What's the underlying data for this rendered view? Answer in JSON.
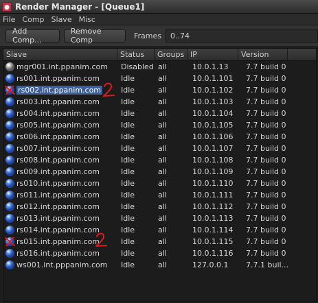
{
  "window": {
    "title": "Render Manager - [Queue1]"
  },
  "menu": [
    "File",
    "Comp",
    "Slave",
    "Misc"
  ],
  "toolbar": {
    "add_comp": "Add Comp...",
    "remove_comp": "Remove Comp",
    "frames_label": "Frames",
    "frames_value": "0..74"
  },
  "columns": [
    "Slave",
    "Status",
    "Groups",
    "IP",
    "Version"
  ],
  "rows": [
    {
      "slave": "mgr001.int.ppanim.com",
      "status": "Disabled",
      "groups": "all",
      "ip": "10.0.1.13",
      "version": "7.7 build 0",
      "icon": "gray-sphere-icon",
      "marked": false,
      "selected": false
    },
    {
      "slave": "rs001.int.ppanim.com",
      "status": "Idle",
      "groups": "all",
      "ip": "10.0.1.101",
      "version": "7.7 build 0",
      "icon": "blue-sphere-icon",
      "marked": false,
      "selected": false
    },
    {
      "slave": "rs002.int.ppanim.com",
      "status": "Idle",
      "groups": "all",
      "ip": "10.0.1.102",
      "version": "7.7 build 0",
      "icon": "blue-sphere-icon",
      "marked": true,
      "selected": true
    },
    {
      "slave": "rs003.int.ppanim.com",
      "status": "Idle",
      "groups": "all",
      "ip": "10.0.1.103",
      "version": "7.7 build 0",
      "icon": "blue-sphere-icon",
      "marked": false,
      "selected": false
    },
    {
      "slave": "rs004.int.ppanim.com",
      "status": "Idle",
      "groups": "all",
      "ip": "10.0.1.104",
      "version": "7.7 build 0",
      "icon": "blue-sphere-icon",
      "marked": false,
      "selected": false
    },
    {
      "slave": "rs005.int.ppanim.com",
      "status": "Idle",
      "groups": "all",
      "ip": "10.0.1.105",
      "version": "7.7 build 0",
      "icon": "blue-sphere-icon",
      "marked": false,
      "selected": false
    },
    {
      "slave": "rs006.int.ppanim.com",
      "status": "Idle",
      "groups": "all",
      "ip": "10.0.1.106",
      "version": "7.7 build 0",
      "icon": "blue-sphere-icon",
      "marked": false,
      "selected": false
    },
    {
      "slave": "rs007.int.ppanim.com",
      "status": "Idle",
      "groups": "all",
      "ip": "10.0.1.107",
      "version": "7.7 build 0",
      "icon": "blue-sphere-icon",
      "marked": false,
      "selected": false
    },
    {
      "slave": "rs008.int.ppanim.com",
      "status": "Idle",
      "groups": "all",
      "ip": "10.0.1.108",
      "version": "7.7 build 0",
      "icon": "blue-sphere-icon",
      "marked": false,
      "selected": false
    },
    {
      "slave": "rs009.int.ppanim.com",
      "status": "Idle",
      "groups": "all",
      "ip": "10.0.1.109",
      "version": "7.7 build 0",
      "icon": "blue-sphere-icon",
      "marked": false,
      "selected": false
    },
    {
      "slave": "rs010.int.ppanim.com",
      "status": "Idle",
      "groups": "all",
      "ip": "10.0.1.110",
      "version": "7.7 build 0",
      "icon": "blue-sphere-icon",
      "marked": false,
      "selected": false
    },
    {
      "slave": "rs011.int.ppanim.com",
      "status": "Idle",
      "groups": "all",
      "ip": "10.0.1.111",
      "version": "7.7 build 0",
      "icon": "blue-sphere-icon",
      "marked": false,
      "selected": false
    },
    {
      "slave": "rs012.int.ppanim.com",
      "status": "Idle",
      "groups": "all",
      "ip": "10.0.1.112",
      "version": "7.7 build 0",
      "icon": "blue-sphere-icon",
      "marked": false,
      "selected": false
    },
    {
      "slave": "rs013.int.ppanim.com",
      "status": "Idle",
      "groups": "all",
      "ip": "10.0.1.113",
      "version": "7.7 build 0",
      "icon": "blue-sphere-icon",
      "marked": false,
      "selected": false
    },
    {
      "slave": "rs014.int.ppanim.com",
      "status": "Idle",
      "groups": "all",
      "ip": "10.0.1.114",
      "version": "7.7 build 0",
      "icon": "blue-sphere-icon",
      "marked": false,
      "selected": false
    },
    {
      "slave": "rs015.int.ppanim.com",
      "status": "Idle",
      "groups": "all",
      "ip": "10.0.1.115",
      "version": "7.7 build 0",
      "icon": "blue-sphere-icon",
      "marked": true,
      "selected": false
    },
    {
      "slave": "rs016.int.ppanim.com",
      "status": "Idle",
      "groups": "all",
      "ip": "10.0.1.116",
      "version": "7.7 build 0",
      "icon": "blue-sphere-icon",
      "marked": false,
      "selected": false
    },
    {
      "slave": "ws001.int.pppanim.com",
      "status": "Idle",
      "groups": "all",
      "ip": "127.0.0.1",
      "version": "7.7.1 buil...",
      "icon": "blue-sphere-icon",
      "marked": false,
      "selected": false
    }
  ],
  "annotations": [
    "2",
    "2"
  ],
  "colors": {
    "annotation": "#e01818",
    "selection": "#3d5f9a",
    "accent": "#c0344a"
  }
}
